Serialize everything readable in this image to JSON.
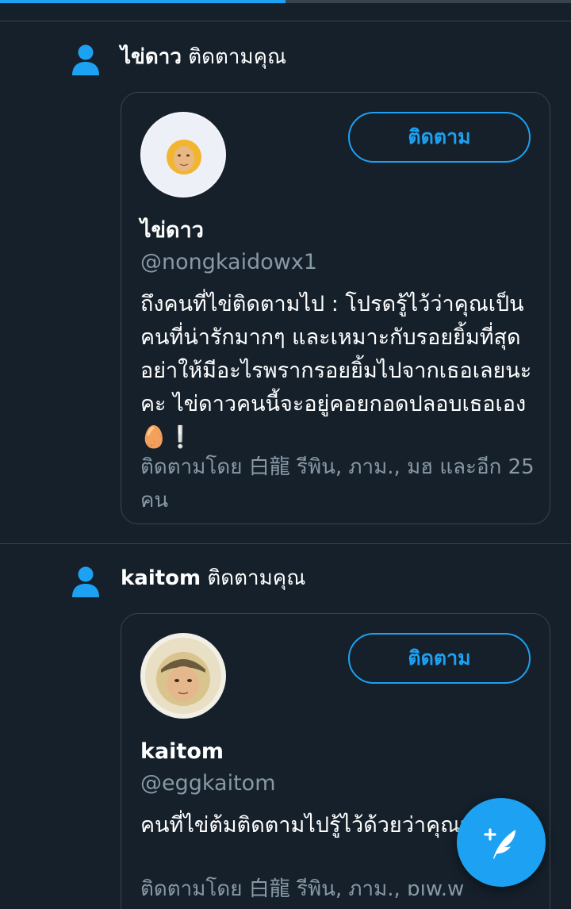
{
  "notifications": [
    {
      "user_name": "ไข่ดาว",
      "action_text": " ติดตามคุณ",
      "card": {
        "display_name": "ไข่ดาว",
        "handle": "@nongkaidowx1",
        "follow_label": "ติดตาม",
        "bio": "ถึงคนที่ไข่ติดตามไป : โปรดรู้ไว้ว่าคุณเป็นคนที่น่ารักมากๆ และเหมาะกับรอยยิ้มที่สุด อย่าให้มีอะไรพรากรอยยิ้มไปจากเธอเลยนะคะ ไข่ดาวคนนี้จะอยู่คอยกอดปลอบเธอเอง🥚❕",
        "followed_by": "ติดตามโดย 白龍 รีพิน, ภาม., มฮ และอีก 25 คน"
      }
    },
    {
      "user_name": "kaitom",
      "action_text": " ติดตามคุณ",
      "card": {
        "display_name": "kaitom",
        "handle": "@eggkaitom",
        "follow_label": "ติดตาม",
        "bio": "คนที่ไข่ต้มติดตามไปรู้ไว้ด้วยว่าคุณน่ารัก",
        "followed_by": "ติดตามโดย 白龍 รีพิน, ภาม., ɒıw.w"
      }
    }
  ],
  "colors": {
    "background": "#15202b",
    "accent": "#1da1f2",
    "secondary_text": "#8899a6",
    "border": "#38444d"
  },
  "icons": {
    "notification_type": "person-icon",
    "compose": "compose-tweet-icon"
  }
}
